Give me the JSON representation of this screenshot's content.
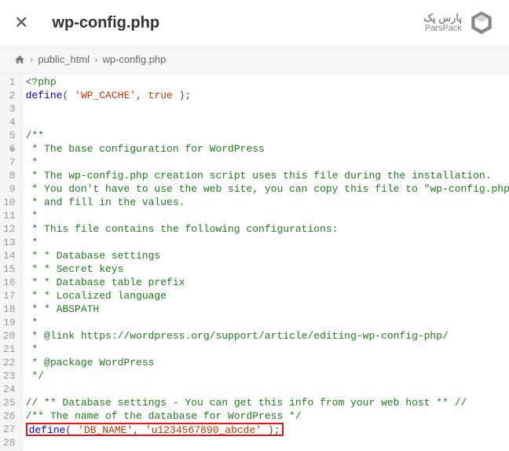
{
  "header": {
    "filename": "wp-config.php",
    "brand_line1": "پارس پک",
    "brand_line2": "ParsPack"
  },
  "breadcrumb": {
    "items": [
      "public_html",
      "wp-config.php"
    ]
  },
  "code": {
    "lines": [
      {
        "n": 1,
        "t": "phptag",
        "raw": "<?php"
      },
      {
        "n": 2,
        "t": "define",
        "fn": "define",
        "p1": "'WP_CACHE'",
        "p2": "true",
        "p2type": "const"
      },
      {
        "n": 3,
        "t": "blank"
      },
      {
        "n": 4,
        "t": "blank"
      },
      {
        "n": 5,
        "t": "cmt",
        "raw": "/**",
        "fold": true
      },
      {
        "n": 6,
        "t": "cmt",
        "raw": " * The base configuration for WordPress"
      },
      {
        "n": 7,
        "t": "cmt",
        "raw": " *"
      },
      {
        "n": 8,
        "t": "cmt",
        "raw": " * The wp-config.php creation script uses this file during the installation."
      },
      {
        "n": 9,
        "t": "cmt",
        "raw": " * You don't have to use the web site, you can copy this file to \"wp-config.php\""
      },
      {
        "n": 10,
        "t": "cmt",
        "raw": " * and fill in the values."
      },
      {
        "n": 11,
        "t": "cmt",
        "raw": " *"
      },
      {
        "n": 12,
        "t": "cmt",
        "raw": " * This file contains the following configurations:"
      },
      {
        "n": 13,
        "t": "cmt",
        "raw": " *"
      },
      {
        "n": 14,
        "t": "cmt",
        "raw": " * * Database settings"
      },
      {
        "n": 15,
        "t": "cmt",
        "raw": " * * Secret keys"
      },
      {
        "n": 16,
        "t": "cmt",
        "raw": " * * Database table prefix"
      },
      {
        "n": 17,
        "t": "cmt",
        "raw": " * * Localized language"
      },
      {
        "n": 18,
        "t": "cmt",
        "raw": " * * ABSPATH"
      },
      {
        "n": 19,
        "t": "cmt",
        "raw": " *"
      },
      {
        "n": 20,
        "t": "cmt",
        "raw": " * @link https://wordpress.org/support/article/editing-wp-config-php/"
      },
      {
        "n": 21,
        "t": "cmt",
        "raw": " *"
      },
      {
        "n": 22,
        "t": "cmt",
        "raw": " * @package WordPress"
      },
      {
        "n": 23,
        "t": "cmt",
        "raw": " */"
      },
      {
        "n": 24,
        "t": "blank"
      },
      {
        "n": 25,
        "t": "cmt",
        "raw": "// ** Database settings - You can get this info from your web host ** //"
      },
      {
        "n": 26,
        "t": "cmt",
        "raw": "/** The name of the database for WordPress */"
      },
      {
        "n": 27,
        "t": "define",
        "fn": "define",
        "p1": "'DB_NAME'",
        "p2": "'u1234567890_abcde'",
        "p2type": "str",
        "highlight": true
      },
      {
        "n": 28,
        "t": "blank"
      }
    ]
  }
}
